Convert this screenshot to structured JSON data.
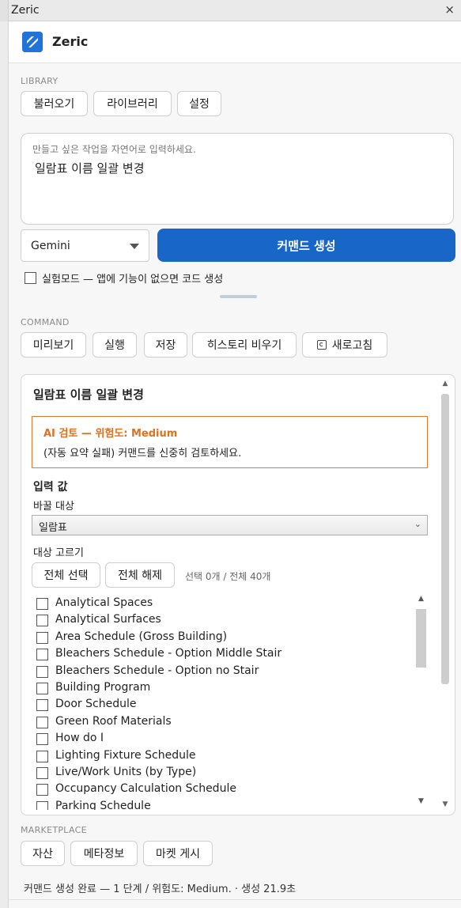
{
  "window": {
    "title": "Zeric",
    "close": "×"
  },
  "app": {
    "title": "Zeric"
  },
  "library": {
    "label": "LIBRARY",
    "buttons": [
      "불러오기",
      "라이브러리",
      "설정"
    ]
  },
  "prompt": {
    "placeholder": "만들고 싶은 작업을 자연어로 입력하세요.",
    "value": "일람표 이름 일괄 변경"
  },
  "model": {
    "selected": "Gemini"
  },
  "generate_button": "커맨드 생성",
  "experimental": {
    "label": "실험모드 — 앱에 기능이 없으면 코드 생성",
    "checked": false
  },
  "command": {
    "label": "COMMAND",
    "buttons": [
      "미리보기",
      "실행",
      "저장",
      "히스토리 비우기",
      "새로고침"
    ]
  },
  "card": {
    "title": "일람표 이름 일괄 변경",
    "warning": {
      "heading": "AI 검토 — 위험도: Medium",
      "body": "(자동 요약 실패) 커맨드를 신중히 검토하세요."
    },
    "inputs_heading": "입력 값",
    "replace_target_label": "바꿀 대상",
    "replace_target_value": "일람표",
    "pick_targets_label": "대상 고르기",
    "select_all": "전체 선택",
    "deselect_all": "전체 해제",
    "selection_count": "선택 0개 / 전체 40개",
    "items": [
      "Analytical Spaces",
      "Analytical Surfaces",
      "Area Schedule (Gross Building)",
      "Bleachers Schedule - Option Middle Stair",
      "Bleachers Schedule - Option no Stair",
      "Building Program",
      "Door Schedule",
      "Green Roof Materials",
      "How do I",
      "Lighting Fixture Schedule",
      "Live/Work Units (by Type)",
      "Occupancy Calculation Schedule",
      "Parking Schedule"
    ]
  },
  "marketplace": {
    "label": "MARKETPLACE",
    "buttons": [
      "자산",
      "메타정보",
      "마켓 게시"
    ]
  },
  "status": "커맨드 생성 완료 — 1 단계 / 위험도: Medium. · 생성 21.9초",
  "colors": {
    "accent": "#1766c8",
    "warning": "#e0701e"
  }
}
